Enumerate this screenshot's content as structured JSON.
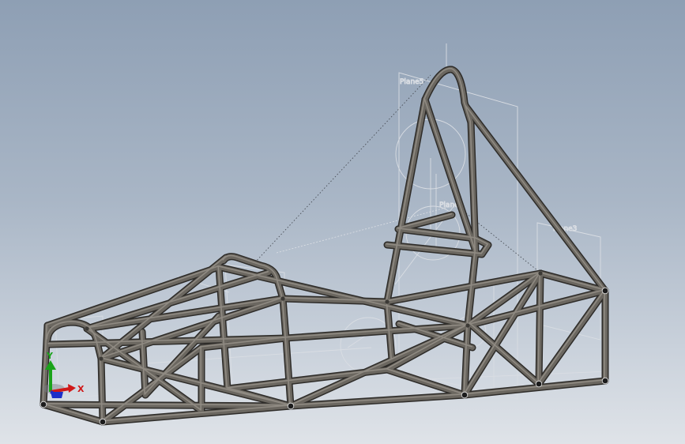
{
  "viewport": {
    "background_top": "#8e9fb4",
    "background_bottom": "#dfe3e8"
  },
  "colors": {
    "tube": "#6b6760",
    "tube_edge": "#2e2c29",
    "tube_highlight": "#8f8a82",
    "node": "#1c1c1c",
    "sketch": "#d9dde3",
    "axis_x": "#d01818",
    "axis_y": "#1aa31a",
    "axis_z": "#1d2fc9"
  },
  "reference_labels": [
    "Plane5",
    "Plane4",
    "Plane3"
  ],
  "triad": {
    "x_label": "X",
    "y_label": "Y",
    "x_icon": "x-axis-arrow-icon",
    "y_icon": "y-axis-arrow-icon",
    "z_icon": "z-axis-arrow-icon"
  }
}
